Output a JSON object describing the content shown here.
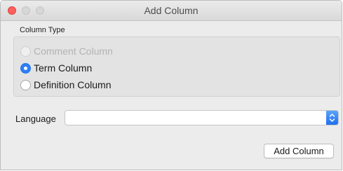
{
  "window": {
    "title": "Add Column"
  },
  "column_type": {
    "label": "Column Type",
    "options": [
      {
        "label": "Comment Column",
        "selected": false,
        "disabled": true
      },
      {
        "label": "Term Column",
        "selected": true,
        "disabled": false
      },
      {
        "label": "Definition Column",
        "selected": false,
        "disabled": false
      }
    ]
  },
  "language": {
    "label": "Language",
    "value": ""
  },
  "actions": {
    "add_label": "Add Column"
  },
  "colors": {
    "close_button": "#fc605c",
    "accent": "#2c7ff7"
  },
  "icons": {
    "select_arrow": "chevron-up-down-icon"
  }
}
